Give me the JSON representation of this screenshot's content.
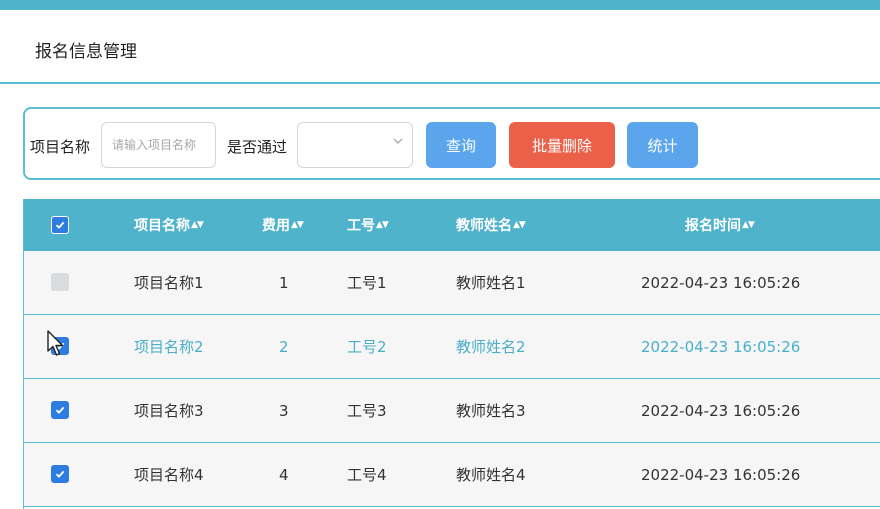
{
  "page": {
    "title": "报名信息管理"
  },
  "filter": {
    "project_label": "项目名称",
    "project_placeholder": "请输入项目名称",
    "passed_label": "是否通过",
    "passed_value": "",
    "query_label": "查询",
    "batch_delete_label": "批量删除",
    "stats_label": "统计"
  },
  "table": {
    "headers": {
      "project": "项目名称",
      "fee": "费用",
      "job_no": "工号",
      "teacher": "教师姓名",
      "time": "报名时间"
    },
    "select_all_checked": true,
    "rows": [
      {
        "project": "项目名称1",
        "fee": "1",
        "job_no": "工号1",
        "teacher": "教师姓名1",
        "time": "2022-04-23 16:05:26",
        "checked": false,
        "highlighted": false
      },
      {
        "project": "项目名称2",
        "fee": "2",
        "job_no": "工号2",
        "teacher": "教师姓名2",
        "time": "2022-04-23 16:05:26",
        "checked": true,
        "highlighted": true
      },
      {
        "project": "项目名称3",
        "fee": "3",
        "job_no": "工号3",
        "teacher": "教师姓名3",
        "time": "2022-04-23 16:05:26",
        "checked": true,
        "highlighted": false
      },
      {
        "project": "项目名称4",
        "fee": "4",
        "job_no": "工号4",
        "teacher": "教师姓名4",
        "time": "2022-04-23 16:05:26",
        "checked": true,
        "highlighted": false
      }
    ]
  },
  "colors": {
    "accent": "#4fb3cb",
    "button_blue": "#5aa5ec",
    "button_red": "#ea6048",
    "checkbox_blue": "#2f7ce0",
    "highlight_text": "#4aaec9"
  },
  "icons": {
    "sort": "sort-arrows-icon",
    "select_chevron": "chevron-down-icon",
    "check": "check-icon",
    "cursor": "mouse-pointer-icon"
  }
}
